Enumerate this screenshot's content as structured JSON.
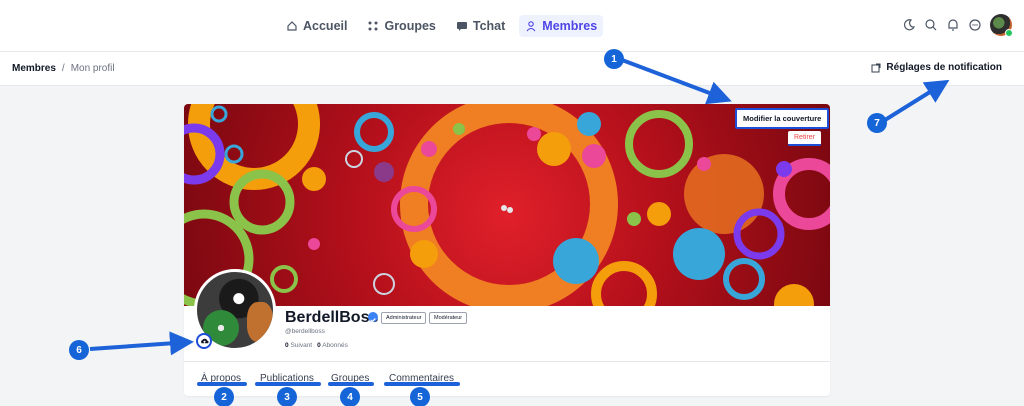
{
  "nav": {
    "items": [
      {
        "label": "Accueil",
        "icon": "home-icon"
      },
      {
        "label": "Groupes",
        "icon": "groups-icon"
      },
      {
        "label": "Tchat",
        "icon": "chat-icon"
      },
      {
        "label": "Membres",
        "icon": "members-icon",
        "active": true
      }
    ]
  },
  "topbar_icons": [
    "moon-icon",
    "search-icon",
    "bell-icon",
    "message-icon",
    "avatar"
  ],
  "breadcrumb": {
    "root": "Membres",
    "separator": "/",
    "current": "Mon profil"
  },
  "notification_settings": {
    "label": "Réglages de notification"
  },
  "cover": {
    "modify_label": "Modifier la couverture",
    "remove_label": "Retirer"
  },
  "profile": {
    "username": "BerdellBoss",
    "handle": "@berdellboss",
    "badges": [
      "Administrateur",
      "Modérateur"
    ],
    "following_count": "0",
    "following_label": "Suivant",
    "followers_count": "0",
    "followers_label": "Abonnés"
  },
  "tabs": [
    "À propos",
    "Publications",
    "Groupes",
    "Commentaires"
  ],
  "markers": [
    "1",
    "2",
    "3",
    "4",
    "5",
    "6",
    "7"
  ],
  "colors": {
    "accent": "#4f46e5",
    "marker": "#1565d8",
    "cover": "#b4101b",
    "danger": "#ef4444"
  }
}
